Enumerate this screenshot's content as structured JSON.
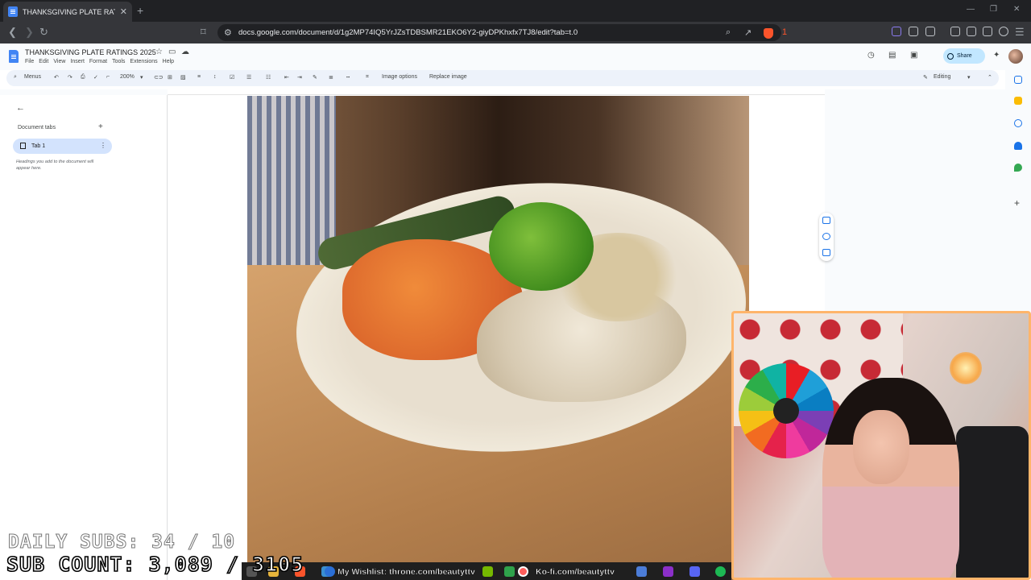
{
  "browser": {
    "tab_title": "THANKSGIVING PLATE RATINGS",
    "tab_close": "✕",
    "new_tab": "+",
    "url": "docs.google.com/document/d/1g2MP74IQ5YrJZsTDBSMR21EKO6Y2-giyDPKhxfx7TJ8/edit?tab=t.0",
    "brave_badge_count": "1",
    "window_controls": [
      "—",
      "❐",
      "✕"
    ]
  },
  "docs": {
    "title": "THANKSGIVING PLATE RATINGS 2025",
    "menus": [
      "File",
      "Edit",
      "View",
      "Insert",
      "Format",
      "Tools",
      "Extensions",
      "Help"
    ],
    "share_label": "Share",
    "toolbar": {
      "search_label": "Menus",
      "zoom": "200%",
      "image_options": "Image options",
      "replace_image": "Replace image",
      "mode": "Editing"
    },
    "outline": {
      "doc_tabs_label": "Document tabs",
      "tab_name": "Tab 1",
      "hint": "Headings you add to the document will appear here."
    }
  },
  "stream": {
    "daily_subs": "DAILY SUBS: 34 / 10",
    "sub_count": "SUB COUNT: 3,089 / 3105",
    "wishlist": "My Wishlist: throne.com/beautyttv",
    "kofi": "Ko-fi.com/beautyttv"
  },
  "colors": {
    "accent": "#0b57d0",
    "share_bg": "#c2e7ff",
    "webcam_border": "#ffb56b"
  }
}
